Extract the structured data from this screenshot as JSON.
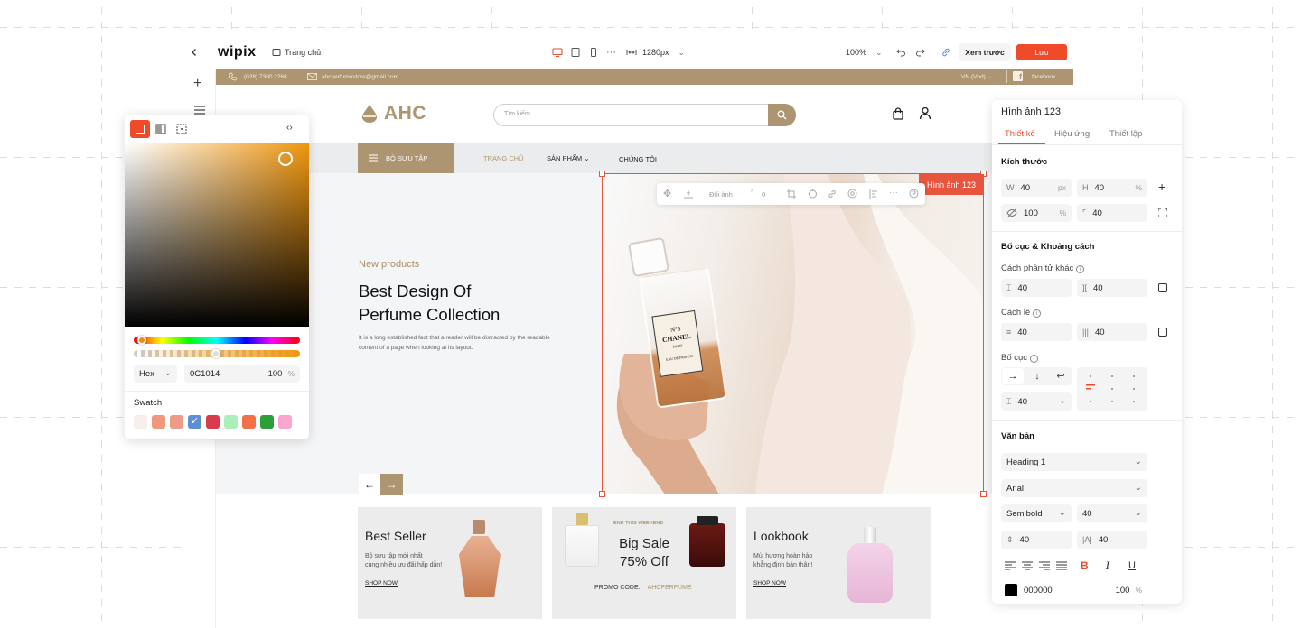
{
  "topbar": {
    "logo": "wipix",
    "page_name": "Trang chủ",
    "width_value": "1280px",
    "zoom": "100%",
    "preview_label": "Xem trước",
    "save_label": "Lưu"
  },
  "site": {
    "phone": "(028) 7300 2268",
    "email": "ahcperfumestore@gmail.com",
    "language": "VN (Vnd)",
    "social": "facebook",
    "logo_text": "AHC",
    "search_placeholder": "Tìm kiếm...",
    "nav": {
      "collection": "BỘ SƯU TẬP",
      "home": "TRANG CHỦ",
      "products": "SẢN PHẨM",
      "about": "CHÚNG TÔI"
    },
    "hero": {
      "eyebrow": "New products",
      "title_line1": "Best Design Of",
      "title_line2": "Perfume Collection",
      "desc_line1": "It is a long established fact that a reader will be distracted by the readable",
      "desc_line2": "content of a page when looking at its layout."
    },
    "bottle_label": {
      "line1": "N°5",
      "line2": "CHANEL",
      "line3": "PARIS",
      "line4": "EAU DE PARFUM"
    },
    "selection_label": "Hình ảnh 123",
    "element_toolbar": {
      "change_image": "Đổi ảnh",
      "radius": "0"
    },
    "cards": [
      {
        "title": "Best Seller",
        "desc_line1": "Bộ sưu tập mới nhất",
        "desc_line2": "cùng nhiều ưu đãi hấp dẫn!",
        "link": "SHOP NOW"
      },
      {
        "eyebrow": "END THIS WEEKEND",
        "title_line1": "Big Sale",
        "title_line2": "75% Off",
        "promo_label": "PROMO CODE:",
        "promo_code": "AHCPERFUME"
      },
      {
        "title": "Lookbook",
        "desc_line1": "Mùi hương hoàn hảo",
        "desc_line2": "khẳng định bản thân!",
        "link": "SHOP NOW"
      }
    ]
  },
  "picker": {
    "format": "Hex",
    "hex_value": "0C1014",
    "opacity": "100",
    "opacity_unit": "%",
    "swatch_title": "Swatch",
    "swatches": [
      "#f9eeee",
      "#f2967c",
      "#ee9a86",
      "#5b8fd6",
      "#d83a4e",
      "#a8f0b8",
      "#f47148",
      "#2b9f3a",
      "#fba6cc"
    ]
  },
  "panel": {
    "title": "Hình ảnh 123",
    "tabs": [
      "Thiết kế",
      "Hiệu ứng",
      "Thiết lập"
    ],
    "size_title": "Kích thước",
    "width": {
      "prefix": "W",
      "value": "40",
      "unit": "px"
    },
    "height": {
      "prefix": "H",
      "value": "40",
      "unit": "%"
    },
    "opacity": {
      "value": "100",
      "unit": "%"
    },
    "radius": {
      "value": "40"
    },
    "layout_title": "Bố cục & Khoảng cách",
    "gap_label": "Cách phần tử khác",
    "gap_v": "40",
    "gap_h": "40",
    "padding_label": "Cách lề",
    "pad_v": "40",
    "pad_h": "40",
    "flow_label": "Bố cục",
    "flow_gap": "40",
    "text_title": "Văn bản",
    "text_style": "Heading 1",
    "font": "Arial",
    "weight": "Semibold",
    "font_size": "40",
    "line_height": "40",
    "letter_spacing": "40",
    "text_color": "000000",
    "text_opacity": "100",
    "text_opacity_unit": "%"
  },
  "colors": {
    "brand": "#ad9571",
    "accent": "#ef4a2a",
    "selection": "#e8553d"
  }
}
